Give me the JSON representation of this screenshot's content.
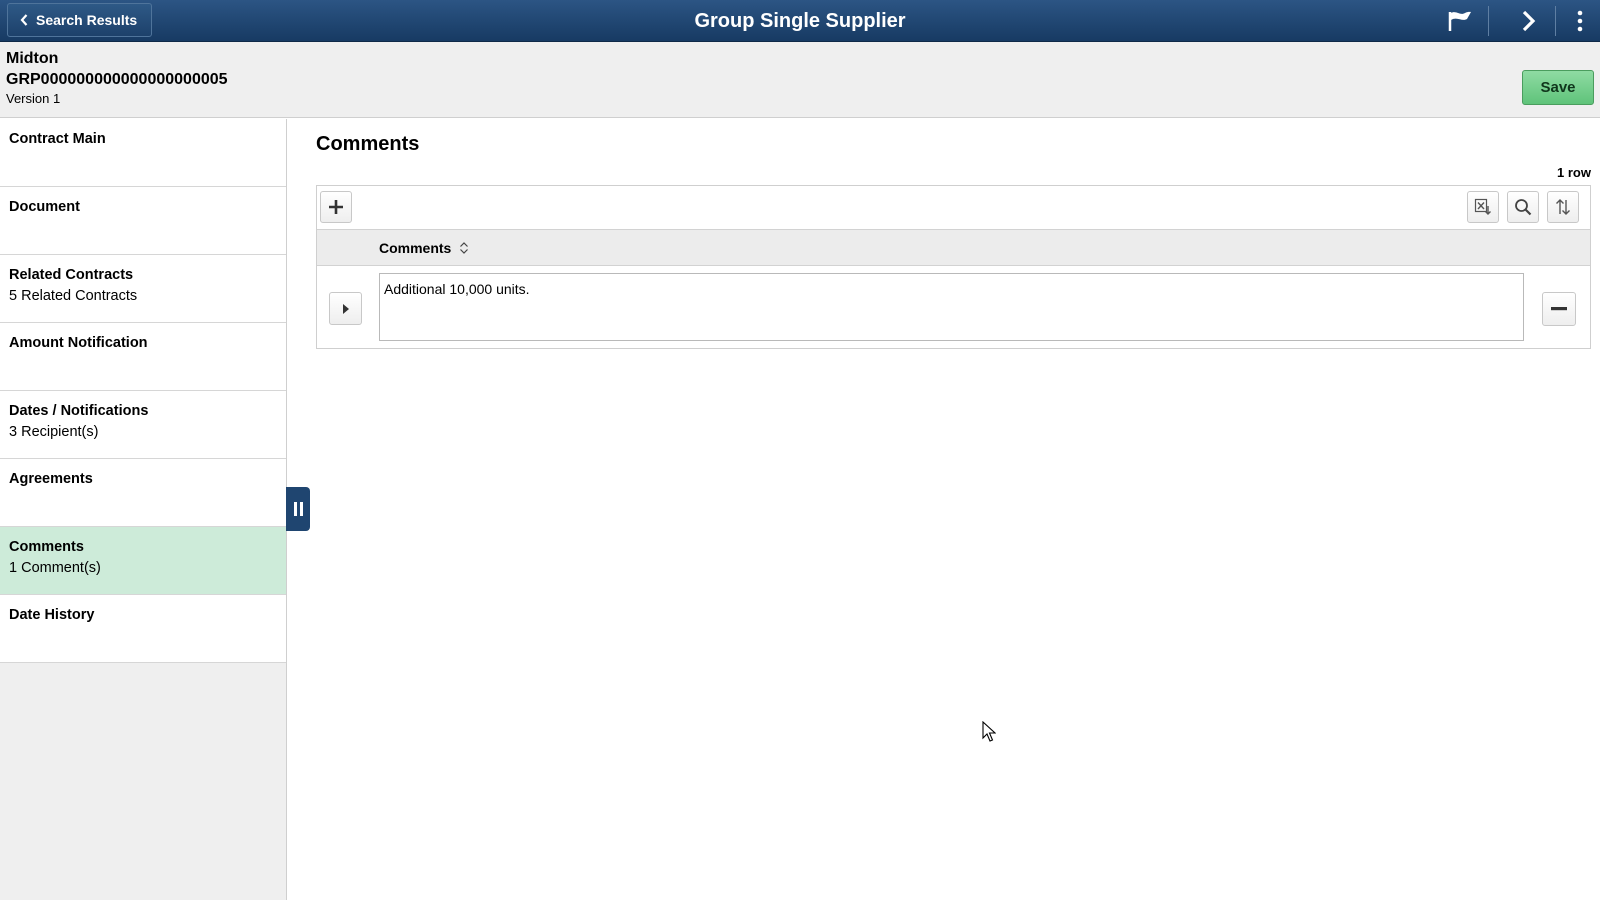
{
  "banner": {
    "back_label": "Search Results",
    "title": "Group Single Supplier",
    "icons": [
      "flag-icon",
      "chevron-right-icon",
      "kebab-menu-icon"
    ]
  },
  "header": {
    "name": "Midton",
    "contract_id": "GRP000000000000000000005",
    "version": "Version 1",
    "save_label": "Save"
  },
  "sidebar": {
    "items": [
      {
        "label": "Contract Main",
        "sub": ""
      },
      {
        "label": "Document",
        "sub": ""
      },
      {
        "label": "Related Contracts",
        "sub": "5 Related Contracts"
      },
      {
        "label": "Amount Notification",
        "sub": ""
      },
      {
        "label": "Dates / Notifications",
        "sub": "3 Recipient(s)"
      },
      {
        "label": "Agreements",
        "sub": ""
      },
      {
        "label": "Comments",
        "sub": "1 Comment(s)",
        "active": true
      },
      {
        "label": "Date History",
        "sub": ""
      }
    ]
  },
  "main": {
    "title": "Comments",
    "row_count": "1 row",
    "grid": {
      "column_header": "Comments",
      "rows": [
        {
          "comment": "Additional 10,000 units."
        }
      ]
    }
  },
  "colors": {
    "banner": "#1f4570",
    "save": "#6cc985",
    "active_nav": "#cdebd9"
  }
}
